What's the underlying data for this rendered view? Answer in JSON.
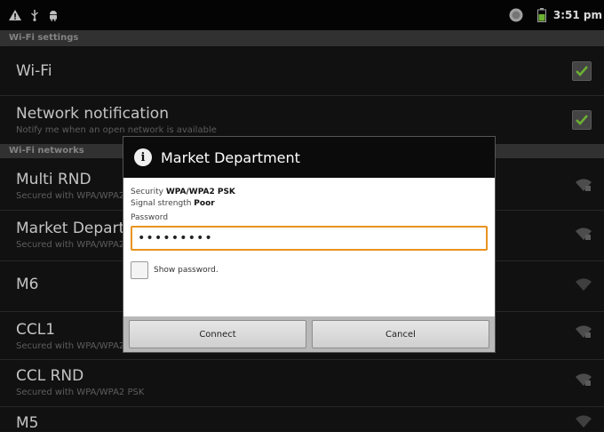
{
  "status_bar": {
    "time": "3:51 pm",
    "icons": [
      "warning-icon",
      "usb-icon",
      "android-icon",
      "sync-icon",
      "battery-icon"
    ]
  },
  "screen": {
    "title": "Wi-Fi settings",
    "wifi": {
      "label": "Wi-Fi",
      "checked": true
    },
    "network_notification": {
      "label": "Network notification",
      "summary": "Notify me when an open network is available",
      "checked": true
    },
    "networks_header": "Wi-Fi networks",
    "networks": [
      {
        "name": "Multi RND",
        "summary": "Secured with WPA/WPA2 PSK"
      },
      {
        "name": "Market Department",
        "summary": "Secured with WPA/WPA2 PSK"
      },
      {
        "name": "M6",
        "summary": ""
      },
      {
        "name": "CCL1",
        "summary": "Secured with WPA/WPA2 PSK"
      },
      {
        "name": "CCL RND",
        "summary": "Secured with WPA/WPA2 PSK"
      },
      {
        "name": "M5",
        "summary": ""
      }
    ]
  },
  "dialog": {
    "title": "Market Department",
    "security_label": "Security",
    "security_value": "WPA/WPA2 PSK",
    "signal_label": "Signal strength",
    "signal_value": "Poor",
    "password_label": "Password",
    "password_value": "•••••••••",
    "show_password_label": "Show password.",
    "show_password_checked": false,
    "connect_label": "Connect",
    "cancel_label": "Cancel"
  },
  "colors": {
    "accent_orange": "#e8931e",
    "check_green": "#7fd13b",
    "battery_green": "#7fd13b"
  }
}
